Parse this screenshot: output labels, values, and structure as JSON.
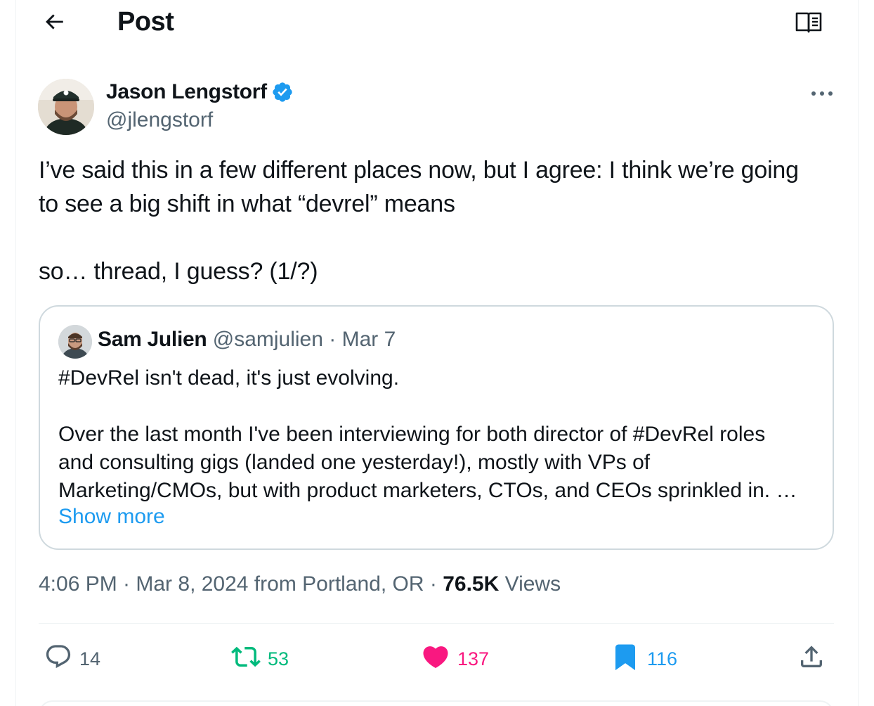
{
  "header": {
    "title": "Post"
  },
  "author": {
    "name": "Jason Lengstorf",
    "handle": "@jlengstorf",
    "verified": true
  },
  "tweet": {
    "lines": [
      "I’ve said this in a few different places now, but I agree: I think we’re going",
      "to see a big shift in what “devrel” means",
      "so… thread, I guess? (1/?)"
    ]
  },
  "quote": {
    "name": "Sam Julien",
    "handle_date": "@samjulien · Mar 7",
    "lines": [
      "#DevRel isn't dead, it's just evolving.",
      "Over the last month I've been interviewing for both director of #DevRel roles",
      "and consulting gigs (landed one yesterday!), mostly with VPs of",
      "Marketing/CMOs, but with product marketers, CTOs, and CEOs sprinkled in. …"
    ],
    "show_more": "Show more"
  },
  "meta": {
    "timestamp": "4:06 PM · Mar 8, 2024 from Portland, OR · ",
    "views_count": "76.5K",
    "views_label": " Views"
  },
  "actions": {
    "replies": "14",
    "retweets": "53",
    "likes": "137",
    "bookmarks": "116"
  },
  "colors": {
    "accent": "#1d9bf0",
    "like": "#f91880",
    "retweet": "#00ba7c",
    "muted": "#536471",
    "text": "#0f1419",
    "border": "#cfd9de"
  },
  "icons": {
    "back": "arrow-left-icon",
    "reader": "book-open-icon",
    "verified": "verified-badge-icon",
    "more": "more-horizontal-icon",
    "reply": "reply-bubble-icon",
    "retweet": "retweet-icon",
    "like": "heart-filled-icon",
    "bookmark": "bookmark-filled-icon",
    "share": "share-upload-icon"
  }
}
